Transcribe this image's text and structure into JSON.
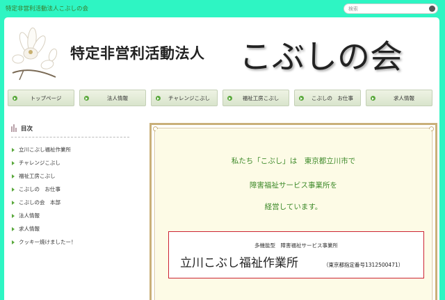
{
  "topbar": {
    "site_name": "特定非営利活動法人こぶしの会",
    "search_placeholder": "検索"
  },
  "banner": {
    "org_type": "特定非営利活動法人",
    "org_name": "こぶしの会",
    "logo_icon": "magnolia-flower-icon"
  },
  "nav": {
    "items": [
      {
        "label": "トップページ"
      },
      {
        "label": "法人情報"
      },
      {
        "label": "チャレンジこぶし"
      },
      {
        "label": "福祉工房こぶし"
      },
      {
        "label": "こぶしの　お仕事"
      },
      {
        "label": "求人情報"
      }
    ]
  },
  "sidebar": {
    "title": "目次",
    "items": [
      {
        "label": "立川こぶし福祉作業所"
      },
      {
        "label": "チャレンジこぶし"
      },
      {
        "label": "福祉工房こぶし"
      },
      {
        "label": "こぶしの　お仕事"
      },
      {
        "label": "こぶしの会　本部"
      },
      {
        "label": "法人情報"
      },
      {
        "label": "求人情報"
      },
      {
        "label": "クッキー焼けましたー！"
      }
    ]
  },
  "main": {
    "intro": [
      "私たち「こぶし」は　東京都立川市で",
      "障害福祉サービス事業所を",
      "経営しています。"
    ],
    "facility": {
      "subtitle": "多機能型　障害福祉サービス事業所",
      "name": "立川こぶし福祉作業所",
      "number": "（東京都指定番号1312500471）"
    }
  },
  "colors": {
    "background": "#2ef5c3",
    "accent_green": "#5aa83c",
    "text_green": "#3e8a2a",
    "frame": "#c9b07a",
    "box_border": "#cc2233"
  }
}
